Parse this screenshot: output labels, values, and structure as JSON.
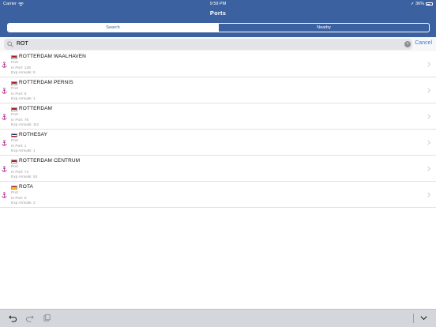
{
  "status_bar": {
    "carrier": "Carrier",
    "time": "9:59 PM",
    "battery": "36%"
  },
  "nav": {
    "title": "Ports",
    "segments": [
      "Search",
      "Nearby"
    ],
    "active_segment": "Search"
  },
  "search": {
    "query": "ROT",
    "cancel_label": "Cancel"
  },
  "ports": [
    {
      "name": "ROTTERDAM WAALHAVEN",
      "flag": "netherlands",
      "type": "Port",
      "in_port": "In Port: 128",
      "exp_arrivals": "Exp Arrivals: 8"
    },
    {
      "name": "ROTTERDAM PERNIS",
      "flag": "netherlands",
      "type": "Port",
      "in_port": "In Port: 8",
      "exp_arrivals": "Exp Arrivals: 1"
    },
    {
      "name": "ROTTERDAM",
      "flag": "netherlands",
      "type": "Port",
      "in_port": "In Port: 76",
      "exp_arrivals": "Exp Arrivals: 111"
    },
    {
      "name": "ROTHESAY",
      "flag": "united-kingdom",
      "type": "Port",
      "in_port": "In Port: 1",
      "exp_arrivals": "Exp Arrivals: 1"
    },
    {
      "name": "ROTTERDAM CENTRUM",
      "flag": "netherlands",
      "type": "Port",
      "in_port": "In Port: 74",
      "exp_arrivals": "Exp Arrivals: 53"
    },
    {
      "name": "ROTA",
      "flag": "spain",
      "type": "Port",
      "in_port": "In Port: 0",
      "exp_arrivals": "Exp Arrivals: 2"
    }
  ],
  "icons": {
    "row": "anchor-icon",
    "accessory": "chevron-right-icon",
    "toolbar": [
      "undo-icon",
      "redo-icon",
      "paste-icon",
      "keyboard-dismiss-icon"
    ]
  },
  "colors": {
    "nav_bar": "#3c61a0",
    "anchor": "#b0208a",
    "link": "#3a7bd5"
  }
}
